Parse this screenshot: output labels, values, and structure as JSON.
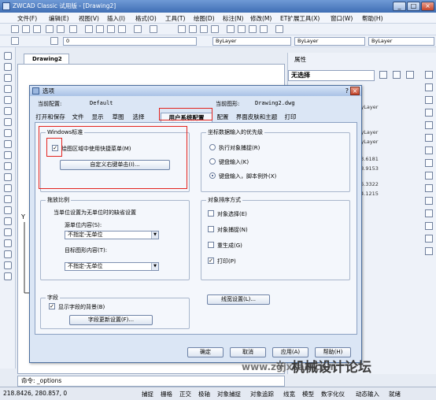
{
  "app": {
    "title": "ZWCAD Classic 试用版 - [Drawing2]",
    "window_buttons": [
      "_",
      "□",
      "×"
    ]
  },
  "menu": [
    "文件(F)",
    "编辑(E)",
    "视图(V)",
    "插入(I)",
    "格式(O)",
    "工具(T)",
    "绘图(D)",
    "标注(N)",
    "修改(M)",
    "ET扩展工具(X)",
    "窗口(W)",
    "帮助(H)"
  ],
  "toolbar": {
    "layer_value": "0",
    "bylayer_color": "ByLayer",
    "bylayer_linetype": "ByLayer",
    "bylayer_lineweight": "ByLayer"
  },
  "drawing_tab": "Drawing2",
  "properties": {
    "title": "属性",
    "selection": "无选择",
    "values": [
      "ByLayer",
      "ByLayer",
      "ByLayer",
      "13.6181",
      "58.9153",
      "46.3322",
      "54.1215"
    ]
  },
  "dialog": {
    "title": "选项",
    "help": "?",
    "close": "×",
    "current_profile_label": "当前配置:",
    "current_profile_value": "Default",
    "current_drawing_label": "当前图形:",
    "current_drawing_value": "Drawing2.dwg",
    "tabs": [
      "打开和保存",
      "文件",
      "显示",
      "草图",
      "选择",
      "用户系统配置",
      "配置",
      "界面皮肤和主题",
      "打印"
    ],
    "windows_group": {
      "title": "Windows标准",
      "shortcut_menu_checkbox": "绘图区域中使用快捷菜单(M)",
      "shortcut_menu_checked": "✓",
      "right_click_button": "自定义右键单击(I)..."
    },
    "coord_group": {
      "title": "坐标数据输入的优先级",
      "options": [
        "执行对象捕捉(R)",
        "键盘输入(K)",
        "键盘输入，脚本例外(X)"
      ]
    },
    "drag_group": {
      "title": "拖放比例",
      "subtitle": "当单位设置为无单位时的缺省设置",
      "source_label": "源单位内容(S):",
      "source_value": "不指定-无单位",
      "target_label": "目标图形内容(T):",
      "target_value": "不指定-无单位"
    },
    "sort_group": {
      "title": "对象排序方式",
      "items": [
        {
          "label": "对象选择(E)",
          "checked": ""
        },
        {
          "label": "对象捕捉(N)",
          "checked": ""
        },
        {
          "label": "重生成(G)",
          "checked": ""
        },
        {
          "label": "打印(P)",
          "checked": "✓"
        }
      ]
    },
    "field_group": {
      "title": "字段",
      "show_background": "显示字段的背景(B)",
      "show_background_checked": "✓",
      "update_settings": "字段更新设置(F)..."
    },
    "lineweight_button": "线宽设置(L)...",
    "buttons": [
      "确定",
      "取消",
      "应用(A)",
      "帮助(H)"
    ]
  },
  "command": "命令: _options",
  "status": {
    "coords": "218.8426, 280.857, 0",
    "toggles": [
      "捕捉",
      "栅格",
      "正交",
      "极轴",
      "对象捕捉",
      "对象追踪",
      "线宽",
      "模型",
      "数字化仪",
      "动态输入",
      "就绪"
    ]
  },
  "watermark": {
    "url": "www.zgjxcad.com",
    "text": "机械设计论坛"
  }
}
